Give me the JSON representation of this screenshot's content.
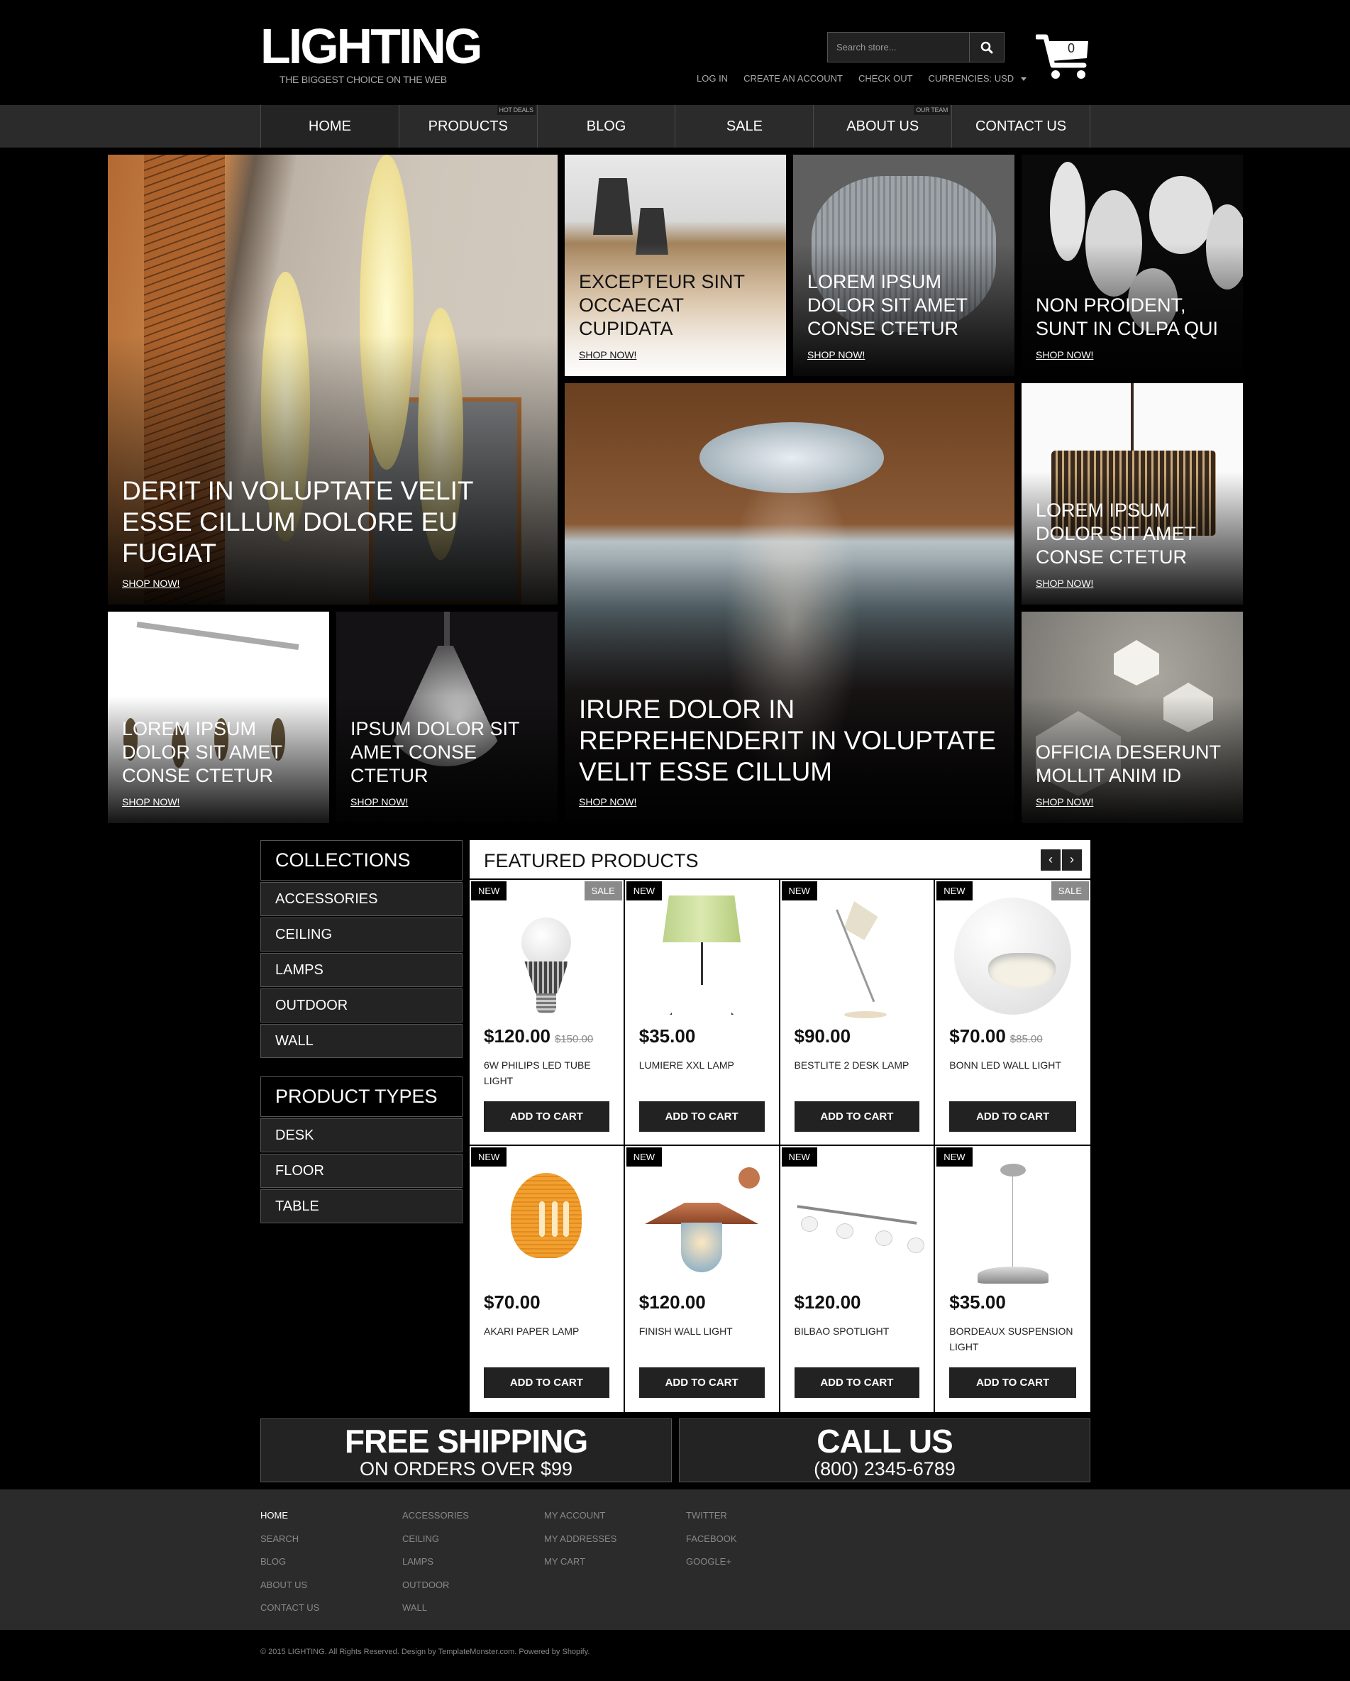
{
  "header": {
    "logo": "LIGHTING",
    "tagline": "THE BIGGEST CHOICE ON THE WEB",
    "search_placeholder": "Search store...",
    "search_icon": "search-icon",
    "cart_icon": "shopping-cart-icon",
    "cart_count": "0",
    "links": {
      "login": "LOG IN",
      "create_account": "CREATE AN ACCOUNT",
      "checkout": "CHECK OUT",
      "currencies": "CURRENCIES:  USD"
    }
  },
  "nav": {
    "items": [
      {
        "label": "HOME",
        "badge": ""
      },
      {
        "label": "PRODUCTS",
        "badge": "HOT DEALS"
      },
      {
        "label": "BLOG",
        "badge": ""
      },
      {
        "label": "SALE",
        "badge": ""
      },
      {
        "label": "ABOUT US",
        "badge": "OUR TEAM"
      },
      {
        "label": "CONTACT US",
        "badge": ""
      }
    ]
  },
  "banners": [
    {
      "title": "DERIT IN VOLUPTATE VELIT ESSE CILLUM DOLORE EU FUGIAT",
      "link": "SHOP NOW!"
    },
    {
      "title": "EXCEPTEUR SINT OCCAECAT CUPIDATA",
      "link": "SHOP NOW!"
    },
    {
      "title": "LOREM IPSUM DOLOR SIT AMET CONSE CTETUR",
      "link": "SHOP NOW!"
    },
    {
      "title": "NON PROIDENT, SUNT IN CULPA QUI",
      "link": "SHOP NOW!"
    },
    {
      "title": "IRURE DOLOR IN REPREHENDERIT IN VOLUPTATE VELIT ESSE CILLUM",
      "link": "SHOP NOW!"
    },
    {
      "title": "LOREM IPSUM DOLOR SIT AMET CONSE CTETUR",
      "link": "SHOP NOW!"
    },
    {
      "title": "LOREM IPSUM DOLOR SIT AMET CONSE CTETUR",
      "link": "SHOP NOW!"
    },
    {
      "title": "IPSUM DOLOR SIT AMET CONSE CTETUR",
      "link": "SHOP NOW!"
    },
    {
      "title": "OFFICIA DESERUNT MOLLIT ANIM ID",
      "link": "SHOP NOW!"
    }
  ],
  "sidebar": {
    "collections": {
      "title": "COLLECTIONS",
      "items": [
        "ACCESSORIES",
        "CEILING",
        "LAMPS",
        "OUTDOOR",
        "WALL"
      ]
    },
    "product_types": {
      "title": "PRODUCT TYPES",
      "items": [
        "DESK",
        "FLOOR",
        "TABLE"
      ]
    }
  },
  "featured": {
    "title": "FEATURED PRODUCTS",
    "prev": "‹",
    "next": "›",
    "add_to_cart": "ADD TO CART",
    "products": [
      {
        "name": "6W PHILIPS LED TUBE LIGHT",
        "price": "$120.00",
        "old_price": "$150.00",
        "badge_new": "NEW",
        "badge_sale": "SALE"
      },
      {
        "name": "LUMIERE XXL LAMP",
        "price": "$35.00",
        "old_price": "",
        "badge_new": "NEW",
        "badge_sale": ""
      },
      {
        "name": "BESTLITE 2 DESK LAMP",
        "price": "$90.00",
        "old_price": "",
        "badge_new": "NEW",
        "badge_sale": ""
      },
      {
        "name": "BONN LED WALL LIGHT",
        "price": "$70.00",
        "old_price": "$85.00",
        "badge_new": "NEW",
        "badge_sale": "SALE"
      },
      {
        "name": "AKARI PAPER LAMP",
        "price": "$70.00",
        "old_price": "",
        "badge_new": "NEW",
        "badge_sale": ""
      },
      {
        "name": "FINISH WALL LIGHT",
        "price": "$120.00",
        "old_price": "",
        "badge_new": "NEW",
        "badge_sale": ""
      },
      {
        "name": "BILBAO SPOTLIGHT",
        "price": "$120.00",
        "old_price": "",
        "badge_new": "NEW",
        "badge_sale": ""
      },
      {
        "name": "BORDEAUX SUSPENSION LIGHT",
        "price": "$35.00",
        "old_price": "",
        "badge_new": "NEW",
        "badge_sale": ""
      }
    ]
  },
  "promos": {
    "shipping": {
      "title": "FREE SHIPPING",
      "subtitle": "ON ORDERS OVER $99"
    },
    "call": {
      "title": "CALL US",
      "subtitle": "(800) 2345-6789"
    }
  },
  "footer": {
    "col1": [
      "HOME",
      "SEARCH",
      "BLOG",
      "ABOUT US",
      "CONTACT US"
    ],
    "col2": [
      "ACCESSORIES",
      "CEILING",
      "LAMPS",
      "OUTDOOR",
      "WALL"
    ],
    "col3": [
      "MY ACCOUNT",
      "MY ADDRESSES",
      "MY CART"
    ],
    "col4": [
      "TWITTER",
      "FACEBOOK",
      "GOOGLE+"
    ],
    "copyright": "© 2015 LIGHTING. All Rights Reserved. Design by TemplateMonster.com. Powered by Shopify."
  }
}
